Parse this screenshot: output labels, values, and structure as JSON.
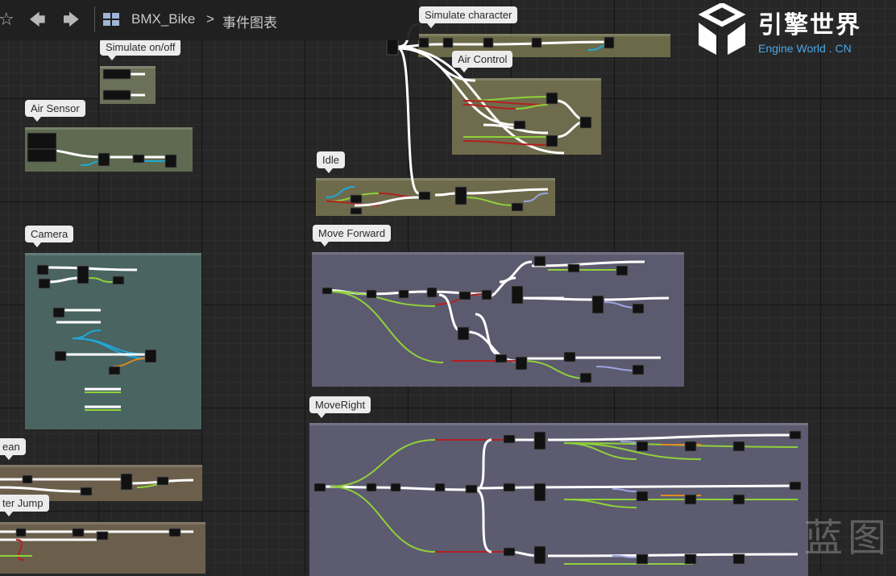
{
  "toolbar": {
    "star_icon": "star-icon",
    "back_icon": "arrow-left-icon",
    "forward_icon": "arrow-right-icon",
    "graph_icon": "event-graph-icon",
    "asset_name": "BMX_Bike",
    "separator": ">",
    "graph_name": "事件图表"
  },
  "comments": {
    "simulate_on_off": "Simulate on/off",
    "simulate_character": "Simulate character",
    "air_sensor": "Air Sensor",
    "air_control": "Air Control",
    "idle": "Idle",
    "camera": "Camera",
    "move_forward": "Move Forward",
    "move_right": "MoveRight",
    "lean": "ean",
    "after_jump": "ter Jump"
  },
  "logo": {
    "title": "引擎世界",
    "subtitle": "Engine World . CN"
  },
  "watermark": "蓝图",
  "colors": {
    "wire_exec": "#ffffff",
    "wire_bool": "#8fd13a",
    "wire_float": "#9fcf3c",
    "wire_vector": "#1fa8d9",
    "wire_red": "#b32020",
    "wire_lilac": "#9aa4e0",
    "wire_orange": "#e08a20"
  }
}
